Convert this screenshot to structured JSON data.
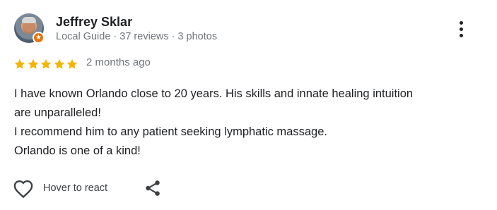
{
  "review": {
    "author_name": "Jeffrey Sklar",
    "author_meta": "Local Guide · 37 reviews · 3 photos",
    "rating": 5,
    "rating_max": 5,
    "time_ago": "2 months ago",
    "text_lines": [
      "I have known Orlando close to 20 years. His skills and innate healing intuition",
      "are unparalleled!",
      "I recommend him to any patient seeking lymphatic massage.",
      "Orlando is one of a kind!"
    ]
  },
  "actions": {
    "react_label": "Hover to react"
  },
  "icons": {
    "avatar": "profile-photo",
    "badge": "local-guide-star-icon",
    "more": "more-vert-icon",
    "like": "heart-outline-icon",
    "share": "share-icon",
    "star": "star-icon"
  },
  "colors": {
    "star": "#f4b400",
    "badge": "#e8710a",
    "secondary_text": "#70757a",
    "primary_text": "#202124"
  }
}
